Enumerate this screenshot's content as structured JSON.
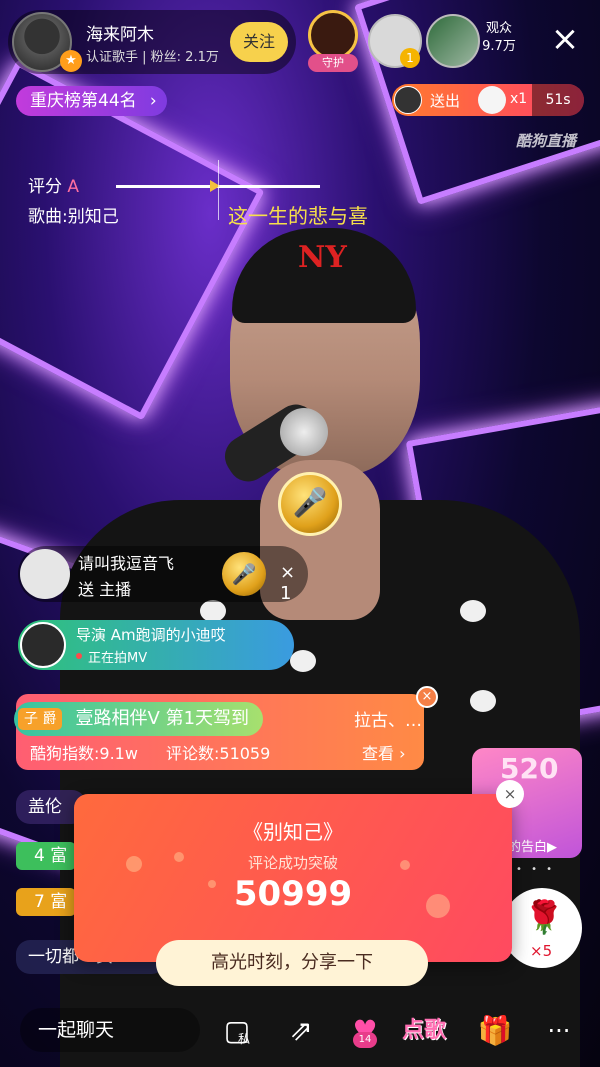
{
  "host": {
    "name": "海来阿木",
    "verified": "认证歌手",
    "fans": "粉丝: 2.1万",
    "follow_label": "关注"
  },
  "guard_label": "守护",
  "viewer_badge": "1",
  "audience": {
    "label": "观众",
    "count": "9.7万"
  },
  "rank": {
    "label": "重庆榜第44名",
    "chevron": "›"
  },
  "gift_banner": {
    "text": "送出",
    "count": "x1",
    "timer": "51s"
  },
  "watermark": "酷狗直播",
  "score": {
    "label": "评分",
    "value": "A"
  },
  "song_line": "歌曲:别知己",
  "lyric": "这一生的悲与喜",
  "chat_gift": {
    "name": "请叫我逗音飞",
    "action": "送 主播",
    "count": "× 1"
  },
  "mv": {
    "title": "导演 Am跑调的小迪哎",
    "status": "正在拍MV"
  },
  "joined": {
    "tag": "子 爵",
    "text": "壹路相伴V 第1天驾到"
  },
  "song_card": {
    "overflow_text": "拉古、…",
    "index": "酷狗指数:9.1w",
    "comments": "评论数:51059",
    "view": "查看 ›",
    "close": "×"
  },
  "side_messages": [
    "盖伦",
    "4 富",
    "7 富",
    "一切都一页"
  ],
  "promo": {
    "title": "520",
    "footer": "的告白▶",
    "dots": "• • •"
  },
  "rose": {
    "icon": "🌹",
    "count": "×5"
  },
  "modal": {
    "title": "《别知己》",
    "subtitle": "评论成功突破",
    "number": "50999",
    "share": "高光时刻，分享一下",
    "close": "×"
  },
  "toolbar": {
    "chat_placeholder": "一起聊天",
    "private_label": "私",
    "heart_badge": "14",
    "sing_label": "点歌",
    "more": "···"
  },
  "colors": {
    "accent_yellow": "#f7d14c",
    "modal_red": "#ff4a60",
    "rank_purple": "#c23bdc"
  }
}
